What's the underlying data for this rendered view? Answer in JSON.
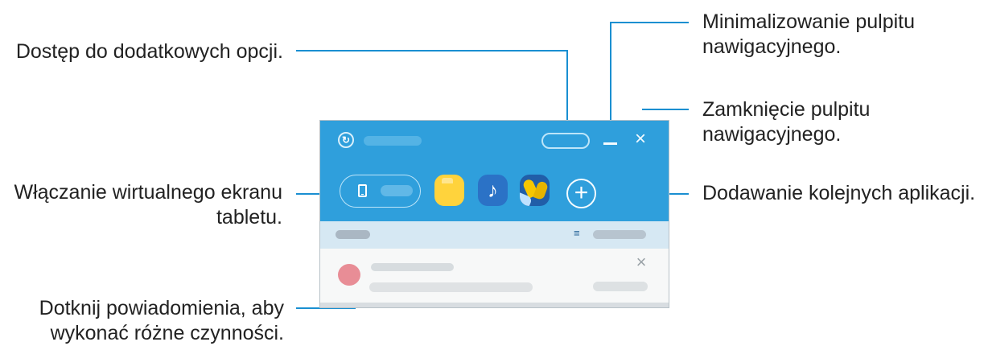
{
  "callouts": {
    "more_options": "Dostęp do dodatkowych opcji.",
    "minimize_line1": "Minimalizowanie pulpitu",
    "minimize_line2": "nawigacyjnego.",
    "close_line1": "Zamknięcie pulpitu",
    "close_line2": "nawigacyjnego.",
    "virtual_screen_line1": "Włączanie wirtualnego ekranu",
    "virtual_screen_line2": "tabletu.",
    "add_apps": "Dodawanie kolejnych aplikacji.",
    "notification_line1": "Dotknij powiadomienia, aby",
    "notification_line2": "wykonać różne czynności."
  },
  "panel": {
    "close_glyph": "×",
    "music_glyph": "♪",
    "add_glyph": "+",
    "notification_close_glyph": "×",
    "sort_glyph": "≡"
  },
  "colors": {
    "header_blue": "#2f9fdc",
    "callout_line": "#1a8fd1",
    "folder": "#ffd33c",
    "music": "#2b72c6",
    "gallery": "#215ea8"
  },
  "icons": {
    "logo": "sync-logo-icon",
    "minimize": "minimize-icon",
    "close": "close-icon",
    "tablet": "tablet-icon",
    "folder": "folder-icon",
    "music": "music-note-icon",
    "gallery": "gallery-leaf-icon",
    "add": "plus-icon",
    "sort": "sort-icon"
  }
}
